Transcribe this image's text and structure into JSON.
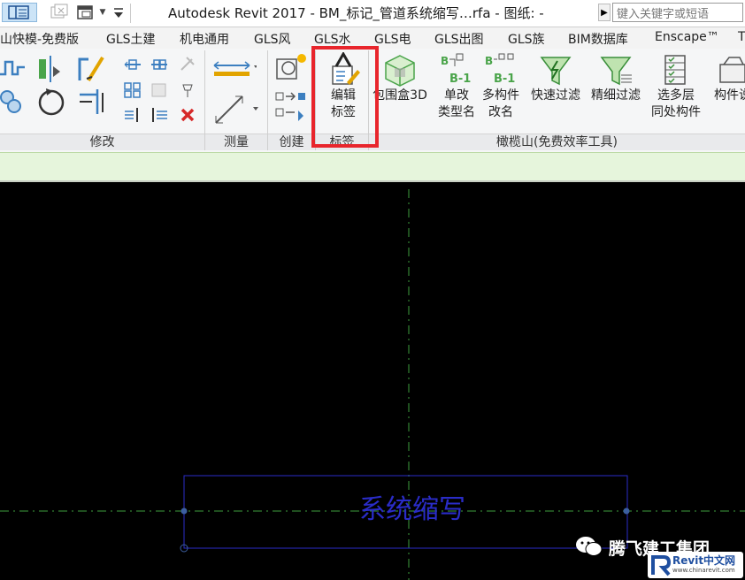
{
  "window": {
    "title": "Autodesk Revit 2017 -     BM_标记_管道系统缩写…rfa - 图纸: -",
    "search_placeholder": "键入关键字或短语"
  },
  "quick_access": {
    "icons": [
      "sheet-layout-icon",
      "close-view-icon",
      "switch-window-icon",
      "dropdown-arrow-icon",
      "customize-icon"
    ]
  },
  "tabs": [
    "山快模-免费版",
    "GLS土建",
    "机电通用",
    "GLS风",
    "GLS水",
    "GLS电",
    "GLS出图",
    "GLS族",
    "BIM数据库",
    "Enscape™",
    "T"
  ],
  "ribbon": {
    "groups": {
      "modify": "修改",
      "measure": "测量",
      "create": "创建",
      "label": "标签",
      "gls": "橄榄山(免费效率工具)"
    },
    "buttons": {
      "edit_label": [
        "编辑",
        "标签"
      ],
      "bbox3d": [
        "包围盒3D",
        ""
      ],
      "rename_single": [
        "单改",
        "类型名"
      ],
      "rename_multi": [
        "多构件",
        "改名"
      ],
      "quick_filter": [
        "快速过滤",
        ""
      ],
      "fine_filter": [
        "精细过滤",
        ""
      ],
      "multi_level": [
        "选多层",
        "同处构件"
      ],
      "component": [
        "构件说",
        ""
      ]
    },
    "icon_glyphs": {
      "b1": "B-1"
    }
  },
  "canvas": {
    "tag_text": "系统缩写"
  },
  "watermark": {
    "company": "腾飞建工集团",
    "logo_text": "Revit中文网",
    "logo_url_text": "www.chinarevit.com"
  },
  "colors": {
    "highlight": "#e8252c",
    "tag_blue": "#2a2cc8",
    "ref_plane_green": "#3e9e3e",
    "ribbon_green_bar": "#e6f5dc"
  }
}
